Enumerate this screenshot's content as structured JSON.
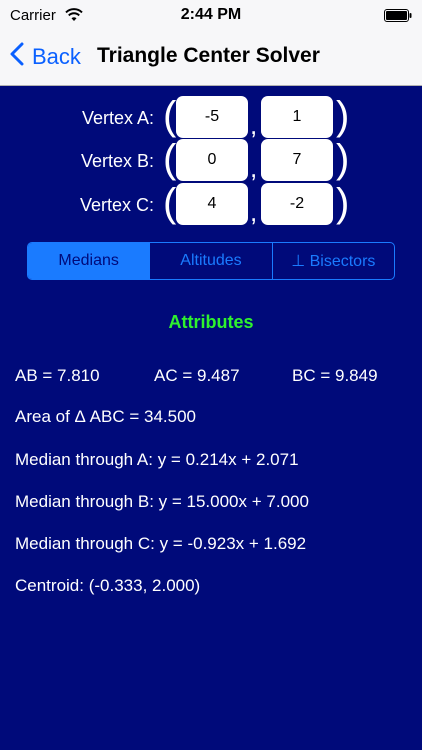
{
  "status": {
    "carrier": "Carrier",
    "time": "2:44 PM"
  },
  "nav": {
    "back_label": "Back",
    "title": "Triangle Center Solver"
  },
  "vertices": [
    {
      "label": "Vertex A:",
      "x": "-5",
      "y": "1"
    },
    {
      "label": "Vertex B:",
      "x": "0",
      "y": "7"
    },
    {
      "label": "Vertex C:",
      "x": "4",
      "y": "-2"
    }
  ],
  "punct": {
    "open": "(",
    "close": ")",
    "comma": ","
  },
  "tabs": [
    {
      "label": "Medians",
      "selected": true
    },
    {
      "label": "Altitudes",
      "selected": false
    },
    {
      "label": "⊥ Bisectors",
      "selected": false
    }
  ],
  "attributes": {
    "heading": "Attributes",
    "ab": "AB = 7.810",
    "ac": "AC = 9.487",
    "bc": "BC = 9.849",
    "area": "Area of Δ ABC = 34.500",
    "median_a": "Median through A: y = 0.214x + 2.071",
    "median_b": "Median through B: y = 15.000x + 7.000",
    "median_c": "Median through C: y = -0.923x + 1.692",
    "centroid": "Centroid: (-0.333, 2.000)"
  },
  "colors": {
    "background": "#000a7a",
    "accent": "#1a7bff",
    "heading": "#2ef22e"
  }
}
